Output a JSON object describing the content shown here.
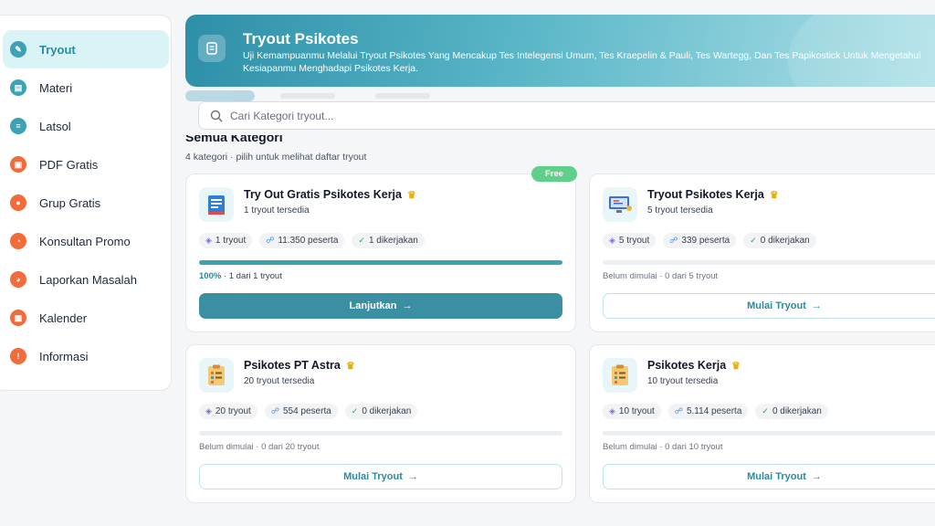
{
  "sidebar": {
    "items": [
      {
        "label": "Tryout",
        "color": "#3ea2b5",
        "icon": "clipboard-icon",
        "active": true
      },
      {
        "label": "Materi",
        "color": "#3ea2b5",
        "icon": "book-icon"
      },
      {
        "label": "Latsol",
        "color": "#3ea2b5",
        "icon": "document-icon"
      },
      {
        "label": "PDF Gratis",
        "color": "#f26b3a",
        "icon": "pdf-icon"
      },
      {
        "label": "Grup Gratis",
        "color": "#f26b3a",
        "icon": "group-icon"
      },
      {
        "label": "Konsultan Promo",
        "color": "#f26b3a",
        "icon": "chat-icon"
      },
      {
        "label": "Laporkan Masalah",
        "color": "#f26b3a",
        "icon": "report-icon"
      },
      {
        "label": "Kalender",
        "color": "#f26b3a",
        "icon": "calendar-icon"
      },
      {
        "label": "Informasi",
        "color": "#f26b3a",
        "icon": "info-icon"
      }
    ]
  },
  "header": {
    "title": "Tryout Psikotes",
    "description": "Uji Kemampuanmu Melalui Tryout Psikotes Yang Mencakup Tes Intelegensi Umum, Tes Kraepelin & Pauli, Tes Wartegg, Dan Tes Papikostick Untuk Mengetahui Kesiapanmu Menghadapi Psikotes Kerja."
  },
  "search": {
    "placeholder": "Cari Kategori tryout..."
  },
  "section": {
    "title": "Semua Kategori",
    "subtitle": "4 kategori · pilih untuk melihat daftar tryout"
  },
  "cards": [
    {
      "title": "Try Out Gratis Psikotes Kerja",
      "count": "1 tryout tersedia",
      "badge": "Free",
      "stats": {
        "tryout": "1 tryout",
        "peserta": "11.350 peserta",
        "dikerjakan": "1 dikerjakan"
      },
      "progress": 1.0,
      "progress_pct": "100%",
      "progress_text": " · 1 dari 1 tryout",
      "button": "Lanjutkan"
    },
    {
      "title": "Tryout Psikotes Kerja",
      "count": "5 tryout tersedia",
      "stats": {
        "tryout": "5 tryout",
        "peserta": "339 peserta",
        "dikerjakan": "0 dikerjakan"
      },
      "progress": 0,
      "progress_text": "Belum dimulai · 0 dari 5 tryout",
      "button": "Mulai Tryout"
    },
    {
      "title": "Psikotes PT Astra",
      "count": "20 tryout tersedia",
      "stats": {
        "tryout": "20 tryout",
        "peserta": "554 peserta",
        "dikerjakan": "0 dikerjakan"
      },
      "progress": 0,
      "progress_text": "Belum dimulai · 0 dari 20 tryout",
      "button": "Mulai Tryout"
    },
    {
      "title": "Psikotes Kerja",
      "count": "10 tryout tersedia",
      "stats": {
        "tryout": "10 tryout",
        "peserta": "5.114 peserta",
        "dikerjakan": "0 dikerjakan"
      },
      "progress": 0,
      "progress_text": "Belum dimulai · 0 dari 10 tryout",
      "button": "Mulai Tryout"
    }
  ],
  "colors": {
    "accent": "#3ea2b5",
    "orange": "#f26b3a",
    "free_badge": "#5fcf8a",
    "crown": "#e5b00b"
  }
}
